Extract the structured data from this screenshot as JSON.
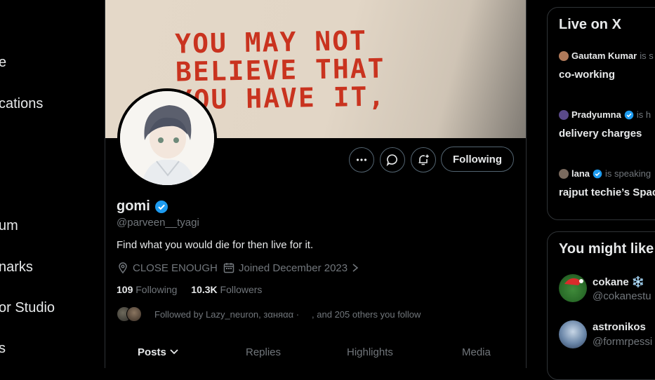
{
  "nav": {
    "items": [
      {
        "label": "e"
      },
      {
        "label": "cations"
      },
      {
        "label": "um"
      },
      {
        "label": "narks"
      },
      {
        "label": "or Studio"
      },
      {
        "label": "s"
      }
    ]
  },
  "banner": {
    "line1": "YOU MAY NOT",
    "line2": "BELIEVE THAT",
    "line3": "YOU HAVE IT,"
  },
  "profile": {
    "name": "gomi",
    "handle": "@parveen__tyagi",
    "bio": "Find what you would die for then live for it.",
    "location": "CLOSE ENOUGH",
    "joined": "Joined December 2023",
    "following_count": "109",
    "following_label": "Following",
    "followers_count": "10.3K",
    "followers_label": "Followers",
    "followed_by": "Followed by Lazy_neuron, зαняαα ·",
    "followed_others": ", and 205 others you follow",
    "verified_color": "#1d9bf0"
  },
  "actions": {
    "more_icon": "more-icon",
    "message_icon": "message-icon",
    "notify_icon": "bell-plus-icon",
    "follow_label": "Following"
  },
  "tabs": [
    {
      "label": "Posts"
    },
    {
      "label": "Replies"
    },
    {
      "label": "Highlights"
    },
    {
      "label": "Media"
    }
  ],
  "live": {
    "title": "Live on X",
    "spaces": [
      {
        "host": "Gautam Kumar",
        "status": "is s",
        "topic": "co-working"
      },
      {
        "host": "Pradyumna",
        "status": "is h",
        "topic": "delivery charges"
      },
      {
        "host": "lana",
        "status": "is speaking",
        "topic": "rajput techie’s Spac"
      }
    ]
  },
  "suggestions": {
    "title": "You might like",
    "users": [
      {
        "name": "cokane",
        "emoji": "❄️",
        "handle": "@cokanestu"
      },
      {
        "name": "astronikos",
        "handle": "@formrpessi"
      }
    ]
  }
}
